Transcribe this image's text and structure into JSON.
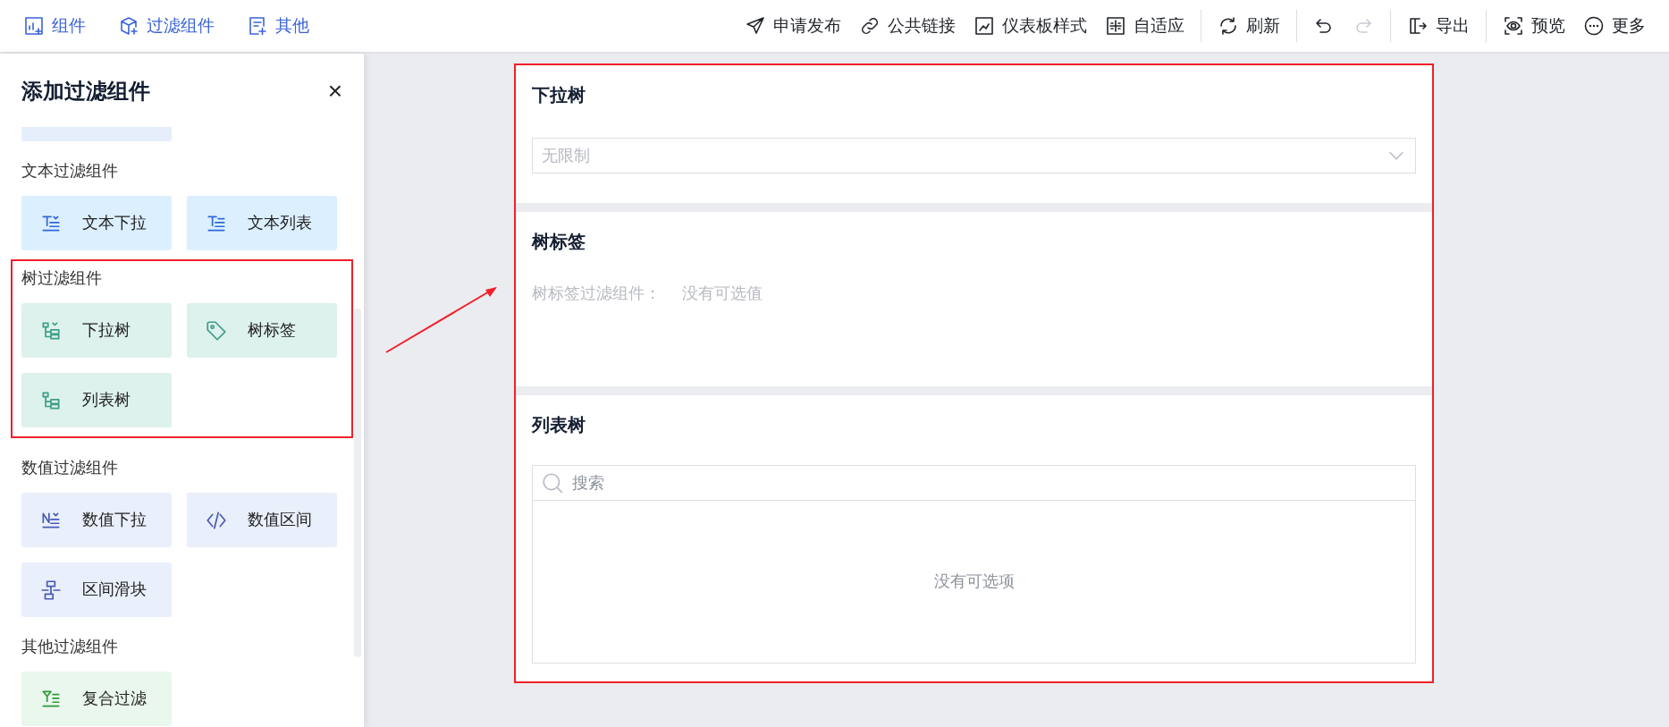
{
  "toolbar": {
    "left": [
      {
        "kind": "component",
        "label": "组件"
      },
      {
        "kind": "filter",
        "label": "过滤组件"
      },
      {
        "kind": "other",
        "label": "其他"
      }
    ],
    "right_groups": [
      [
        {
          "kind": "publish",
          "label": "申请发布"
        },
        {
          "kind": "link",
          "label": "公共链接"
        },
        {
          "kind": "style",
          "label": "仪表板样式"
        },
        {
          "kind": "fit",
          "label": "自适应"
        }
      ],
      [
        {
          "kind": "refresh",
          "label": "刷新"
        }
      ],
      [
        {
          "kind": "undo",
          "disabled": false
        },
        {
          "kind": "redo",
          "disabled": true
        }
      ],
      [
        {
          "kind": "export",
          "label": "导出"
        }
      ],
      [
        {
          "kind": "preview",
          "label": "预览"
        },
        {
          "kind": "more",
          "label": "更多"
        }
      ]
    ]
  },
  "panel": {
    "title": "添加过滤组件",
    "close": "×",
    "groups": [
      {
        "label": "文本过滤组件",
        "color": "#dcefff",
        "highlighted": false,
        "items": [
          {
            "kind": "text-dropdown",
            "label": "文本下拉"
          },
          {
            "kind": "text-list",
            "label": "文本列表"
          }
        ]
      },
      {
        "label": "树过滤组件",
        "color": "#ddf1ed",
        "highlighted": true,
        "items": [
          {
            "kind": "tree-dropdown",
            "label": "下拉树"
          },
          {
            "kind": "tag",
            "label": "树标签"
          },
          {
            "kind": "tree-list",
            "label": "列表树"
          }
        ]
      },
      {
        "label": "数值过滤组件",
        "color": "#e9effb",
        "highlighted": false,
        "items": [
          {
            "kind": "number-dropdown",
            "label": "数值下拉"
          },
          {
            "kind": "code",
            "label": "数值区间"
          },
          {
            "kind": "slider",
            "label": "区间滑块"
          }
        ]
      },
      {
        "label": "其他过滤组件",
        "color": "#eaf7ec",
        "highlighted": false,
        "items": [
          {
            "kind": "compound",
            "label": "复合过滤"
          }
        ]
      }
    ]
  },
  "widgets": [
    {
      "kind": "dropdown",
      "title": "下拉树",
      "placeholder": "无限制"
    },
    {
      "kind": "tags",
      "title": "树标签",
      "label": "树标签过滤组件：",
      "empty": "没有可选值"
    },
    {
      "kind": "list",
      "title": "列表树",
      "placeholder": "搜索",
      "empty": "没有可选项"
    }
  ]
}
